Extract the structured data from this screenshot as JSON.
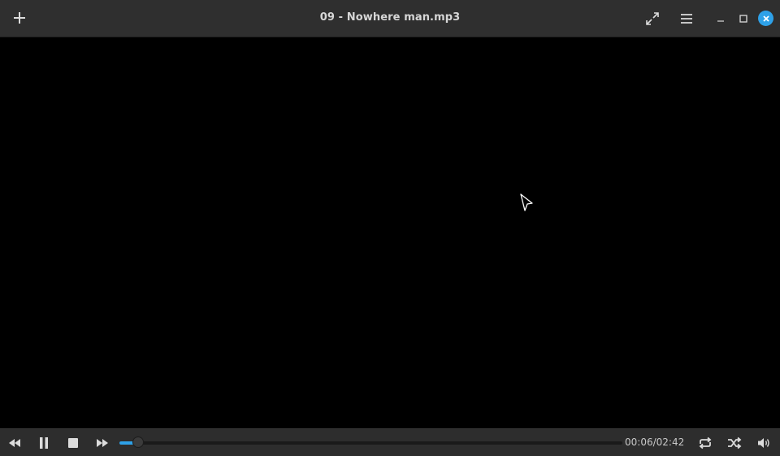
{
  "window": {
    "title": "09 - Nowhere man.mp3"
  },
  "header": {
    "add_icon": "plus-icon",
    "fullscreen_icon": "expand-arrows-icon",
    "menu_icon": "hamburger-menu-icon",
    "minimize_icon": "minimize-icon",
    "maximize_icon": "maximize-icon",
    "close_icon": "close-icon"
  },
  "player": {
    "current_time": "00:06",
    "total_time": "02:42",
    "time_display": "00:06/02:42",
    "progress_fraction": 0.037,
    "state": "playing"
  },
  "controls": {
    "rewind_icon": "rewind-icon",
    "pause_icon": "pause-icon",
    "stop_icon": "stop-icon",
    "forward_icon": "fast-forward-icon",
    "repeat_icon": "repeat-icon",
    "shuffle_icon": "shuffle-icon",
    "volume_icon": "volume-icon"
  },
  "colors": {
    "accent": "#2ea1e8",
    "header_bg": "#2f2f2f",
    "controls_bg": "#2d2d2d",
    "video_bg": "#000000"
  }
}
